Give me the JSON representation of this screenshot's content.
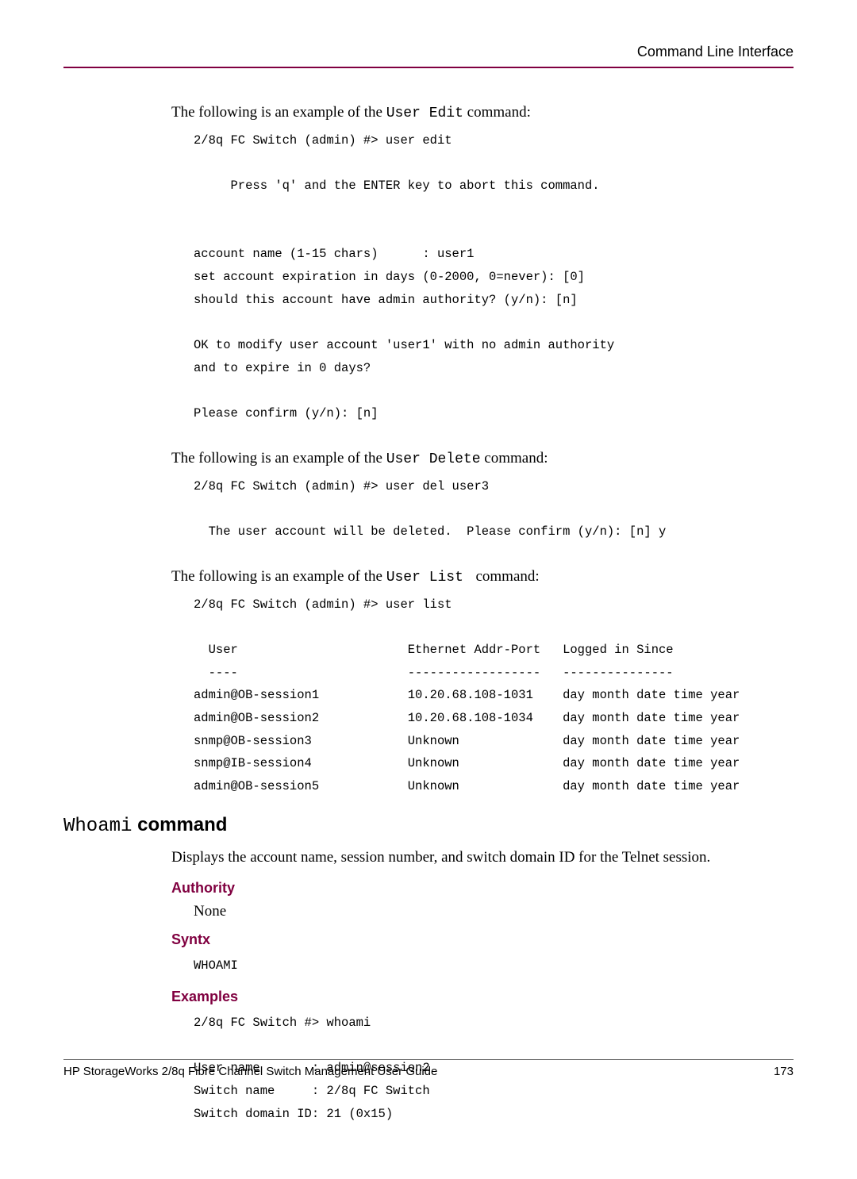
{
  "header": {
    "title": "Command Line Interface"
  },
  "intro1": {
    "prefix": "The following is an example of the ",
    "cmd": "User Edit",
    "suffix": " command:"
  },
  "code1": "2/8q FC Switch (admin) #> user edit\n\n     Press 'q' and the ENTER key to abort this command.\n\n\naccount name (1-15 chars)      : user1\nset account expiration in days (0-2000, 0=never): [0]\nshould this account have admin authority? (y/n): [n]\n\nOK to modify user account 'user1' with no admin authority\nand to expire in 0 days?\n\nPlease confirm (y/n): [n]",
  "intro2": {
    "prefix": "The following is an example of the ",
    "cmd": "User Delete",
    "suffix": " command:"
  },
  "code2": "2/8q FC Switch (admin) #> user del user3\n\n  The user account will be deleted.  Please confirm (y/n): [n] y",
  "intro3": {
    "prefix": "The following is an example of the ",
    "cmd": "User List ",
    "suffix": " command:"
  },
  "code3": "2/8q FC Switch (admin) #> user list\n\n  User                       Ethernet Addr-Port   Logged in Since\n  ----                       ------------------   ---------------\nadmin@OB-session1            10.20.68.108-1031    day month date time year\nadmin@OB-session2            10.20.68.108-1034    day month date time year\nsnmp@OB-session3             Unknown              day month date time year\nsnmp@IB-session4             Unknown              day month date time year\nadmin@OB-session5            Unknown              day month date time year",
  "whoami": {
    "heading_cmd": "Whoami",
    "heading_bold": " command",
    "description": "Displays the account name, session number, and switch domain ID for the Telnet session.",
    "authority_label": "Authority",
    "authority_value": "None",
    "syntax_label": "Syntx",
    "syntax_value": "WHOAMI",
    "examples_label": "Examples",
    "examples_code": "2/8q FC Switch #> whoami\n\nUser name       : admin@session2\nSwitch name     : 2/8q FC Switch\nSwitch domain ID: 21 (0x15)"
  },
  "footer": {
    "left": "HP StorageWorks 2/8q Fibre Channel Switch Management User Guide",
    "right": "173"
  }
}
